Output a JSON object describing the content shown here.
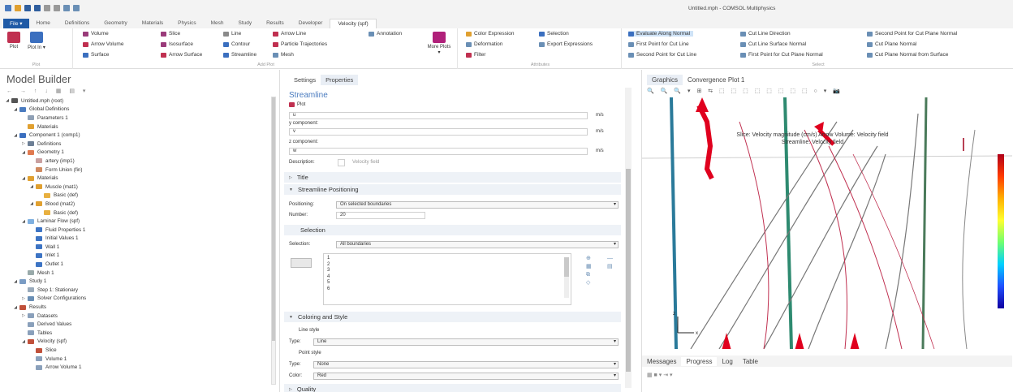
{
  "window": {
    "title": "Untitled.mph - COMSOL Multiphysics"
  },
  "ribbon_tabs": {
    "file": "File ▾",
    "tabs": [
      "Home",
      "Definitions",
      "Geometry",
      "Materials",
      "Physics",
      "Mesh",
      "Study",
      "Results",
      "Developer",
      "Velocity (spf)"
    ]
  },
  "ribbon": {
    "plot": "Plot",
    "plot_in": "Plot In ▾",
    "plot_group": "Plot",
    "add_plot_items": [
      "Volume",
      "Slice",
      "Line",
      "Arrow Line",
      "Annotation",
      "Arrow Volume",
      "Isosurface",
      "Contour",
      "Particle Trajectories",
      "Surface",
      "Arrow Surface",
      "Streamline",
      "Mesh"
    ],
    "more_plots": "More Plots ▾",
    "add_plot_group": "Add Plot",
    "attributes": [
      "Color Expression",
      "Selection",
      "Deformation",
      "Export Expressions",
      "Filter"
    ],
    "attributes_group": "Attributes",
    "select_items": [
      "Evaluate Along Normal",
      "Cut Line Direction",
      "Second Point for Cut Plane Normal",
      "First Point for Cut Line",
      "Cut Line Surface Normal",
      "Cut Plane Normal",
      "Second Point for Cut Line",
      "First Point for Cut Plane Normal",
      "Cut Plane Normal from Surface"
    ],
    "select_group": "Select"
  },
  "model_builder": {
    "title": "Model Builder",
    "tree": [
      {
        "label": "Untitled.mph (root)",
        "level": 0,
        "tw": "◢",
        "color": "#555"
      },
      {
        "label": "Global Definitions",
        "level": 1,
        "tw": "◢",
        "color": "#4a7bbf"
      },
      {
        "label": "Parameters 1",
        "level": 2,
        "tw": "",
        "color": "#8fa0b5"
      },
      {
        "label": "Materials",
        "level": 2,
        "tw": "",
        "color": "#e0a030"
      },
      {
        "label": "Component 1 (comp1)",
        "level": 1,
        "tw": "◢",
        "color": "#3b6fbf"
      },
      {
        "label": "Definitions",
        "level": 2,
        "tw": "▷",
        "color": "#6d7f95"
      },
      {
        "label": "Geometry 1",
        "level": 2,
        "tw": "◢",
        "color": "#e07a50"
      },
      {
        "label": "artery (imp1)",
        "level": 3,
        "tw": "",
        "color": "#c9a0a0"
      },
      {
        "label": "Form Union (fin)",
        "level": 3,
        "tw": "",
        "color": "#d08a60"
      },
      {
        "label": "Materials",
        "level": 2,
        "tw": "◢",
        "color": "#e0a030"
      },
      {
        "label": "Muscle (mat1)",
        "level": 3,
        "tw": "◢",
        "color": "#e0a030"
      },
      {
        "label": "Basic (def)",
        "level": 4,
        "tw": "",
        "color": "#e8b040"
      },
      {
        "label": "Blood (mat2)",
        "level": 3,
        "tw": "◢",
        "color": "#e0a030"
      },
      {
        "label": "Basic (def)",
        "level": 4,
        "tw": "",
        "color": "#e8b040"
      },
      {
        "label": "Laminar Flow (spf)",
        "level": 2,
        "tw": "◢",
        "color": "#7fb0e0"
      },
      {
        "label": "Fluid Properties 1",
        "level": 3,
        "tw": "",
        "color": "#3d74c4"
      },
      {
        "label": "Initial Values 1",
        "level": 3,
        "tw": "",
        "color": "#3d74c4"
      },
      {
        "label": "Wall 1",
        "level": 3,
        "tw": "",
        "color": "#3d74c4"
      },
      {
        "label": "Inlet 1",
        "level": 3,
        "tw": "",
        "color": "#3d74c4"
      },
      {
        "label": "Outlet 1",
        "level": 3,
        "tw": "",
        "color": "#3d74c4"
      },
      {
        "label": "Mesh 1",
        "level": 2,
        "tw": "",
        "color": "#9aa"
      },
      {
        "label": "Study 1",
        "level": 1,
        "tw": "◢",
        "color": "#7a9cc4"
      },
      {
        "label": "Step 1: Stationary",
        "level": 2,
        "tw": "",
        "color": "#9ab"
      },
      {
        "label": "Solver Configurations",
        "level": 2,
        "tw": "▷",
        "color": "#6a8fb5"
      },
      {
        "label": "Results",
        "level": 1,
        "tw": "◢",
        "color": "#c0503a"
      },
      {
        "label": "Datasets",
        "level": 2,
        "tw": "▷",
        "color": "#8aa0bb"
      },
      {
        "label": "Derived Values",
        "level": 2,
        "tw": "",
        "color": "#8aa0bb"
      },
      {
        "label": "Tables",
        "level": 2,
        "tw": "",
        "color": "#8aa0bb"
      },
      {
        "label": "Velocity (spf)",
        "level": 2,
        "tw": "◢",
        "color": "#c0503a"
      },
      {
        "label": "Slice",
        "level": 3,
        "tw": "",
        "color": "#c0503a"
      },
      {
        "label": "Volume 1",
        "level": 3,
        "tw": "",
        "color": "#8aa0bb"
      },
      {
        "label": "Arrow Volume 1",
        "level": 3,
        "tw": "",
        "color": "#8aa0bb"
      }
    ]
  },
  "settings": {
    "tab_settings": "Settings",
    "tab_properties": "Properties",
    "heading": "Streamline",
    "plot_button": "Plot",
    "x_value": "u",
    "unit": "m/s",
    "y_label": "y component:",
    "y_value": "v",
    "z_label": "z component:",
    "z_value": "w",
    "description_label": "Description:",
    "description_value": "Velocity field",
    "sec_title": "Title",
    "sec_positioning": "Streamline Positioning",
    "positioning_label": "Positioning:",
    "positioning_value": "On selected boundaries",
    "number_label": "Number:",
    "number_value": "20",
    "sec_selection": "Selection",
    "selection_label": "Selection:",
    "selection_value": "All boundaries",
    "selection_list": [
      "1",
      "2",
      "3",
      "4",
      "5",
      "6"
    ],
    "sec_coloring": "Coloring and Style",
    "line_style_label": "Line style",
    "line_type_label": "Type:",
    "line_type_value": "Line",
    "point_style_label": "Point style",
    "point_type_label": "Type:",
    "point_type_value": "None",
    "color_label": "Color:",
    "color_value": "Red",
    "sec_quality": "Quality"
  },
  "graphics": {
    "tab_graphics": "Graphics",
    "tab_convergence": "Convergence Plot 1",
    "caption_line1": "Slice: Velocity magnitude (cm/s)  Arrow Volume: Velocity field",
    "caption_line2": "Streamline: Velocity field",
    "axis_x": "x",
    "axis_z": "z"
  },
  "messages": {
    "tabs": [
      "Messages",
      "Progress",
      "Log",
      "Table"
    ]
  }
}
